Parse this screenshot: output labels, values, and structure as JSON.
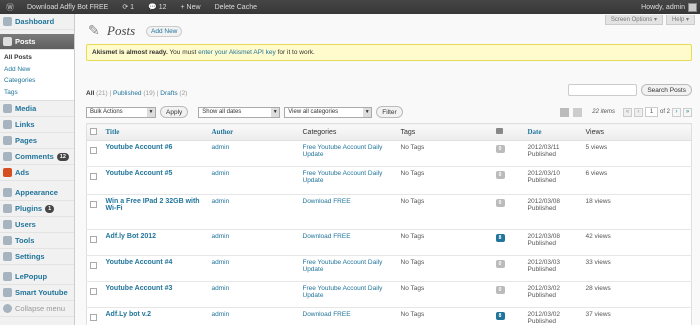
{
  "adminbar": {
    "site": "Download Adfly Bot FREE",
    "updates": "1",
    "comments": "12",
    "new": "+ New",
    "cache": "Delete Cache",
    "howdy": "Howdy, admin"
  },
  "menu": {
    "dashboard": "Dashboard",
    "posts": "Posts",
    "posts_sub": [
      "All Posts",
      "Add New",
      "Categories",
      "Tags"
    ],
    "media": "Media",
    "links": "Links",
    "pages": "Pages",
    "comments": "Comments",
    "comments_count": "12",
    "ads": "Ads",
    "appearance": "Appearance",
    "plugins": "Plugins",
    "plugins_count": "1",
    "users": "Users",
    "tools": "Tools",
    "settings": "Settings",
    "lepopup": "LePopup",
    "smart_youtube": "Smart Youtube",
    "collapse": "Collapse menu"
  },
  "header": {
    "title": "Posts",
    "add_new": "Add New",
    "screen_options": "Screen Options ▾",
    "help": "Help ▾"
  },
  "notice": {
    "strong": "Akismet is almost ready.",
    "pre": " You must ",
    "link": "enter your Akismet API key",
    "post": " for it to work."
  },
  "views": {
    "all": "All",
    "all_count": " (21)",
    "published": "Published",
    "published_count": " (19)",
    "drafts": "Drafts",
    "drafts_count": " (2)"
  },
  "search": {
    "button": "Search Posts"
  },
  "filters": {
    "bulk": "Bulk Actions",
    "apply": "Apply",
    "dates": "Show all dates",
    "cats": "View all categories",
    "filter": "Filter"
  },
  "pager": {
    "items": "22 items",
    "page": "1",
    "of": "of 2",
    "first": "«",
    "prev": "‹",
    "next": "›",
    "last": "»"
  },
  "columns": {
    "title": "Title",
    "author": "Author",
    "categories": "Categories",
    "tags": "Tags",
    "date": "Date",
    "views": "Views"
  },
  "rows": [
    {
      "title": "Youtube Account #6",
      "author": "admin",
      "categories": "Free Youtube Account Daily Update",
      "tags": "No Tags",
      "comments": "0",
      "date": "2012/03/11",
      "status": "Published",
      "views": "5 views"
    },
    {
      "title": "Youtube Account #5",
      "author": "admin",
      "categories": "Free Youtube Account Daily Update",
      "tags": "No Tags",
      "comments": "0",
      "date": "2012/03/10",
      "status": "Published",
      "views": "6 views"
    },
    {
      "title": "Win a Free IPad 2 32GB with Wi-Fi",
      "author": "admin",
      "categories": "Download FREE",
      "tags": "No Tags",
      "comments": "0",
      "date": "2012/03/08",
      "status": "Published",
      "views": "18 views"
    },
    {
      "title": "Adf.ly Bot 2012",
      "author": "admin",
      "categories": "Download FREE",
      "tags": "No Tags",
      "comments": "8",
      "date": "2012/03/08",
      "status": "Published",
      "views": "42 views"
    },
    {
      "title": "Youtube Account #4",
      "author": "admin",
      "categories": "Free Youtube Account Daily Update",
      "tags": "No Tags",
      "comments": "0",
      "date": "2012/03/03",
      "status": "Published",
      "views": "33 views"
    },
    {
      "title": "Youtube Account #3",
      "author": "admin",
      "categories": "Free Youtube Account Daily Update",
      "tags": "No Tags",
      "comments": "0",
      "date": "2012/03/02",
      "status": "Published",
      "views": "28 views"
    },
    {
      "title": "Adf.Ly bot v.2",
      "author": "admin",
      "categories": "Download FREE",
      "tags": "No Tags",
      "comments": "8",
      "date": "2012/03/02",
      "status": "Published",
      "views": "37 views"
    }
  ]
}
